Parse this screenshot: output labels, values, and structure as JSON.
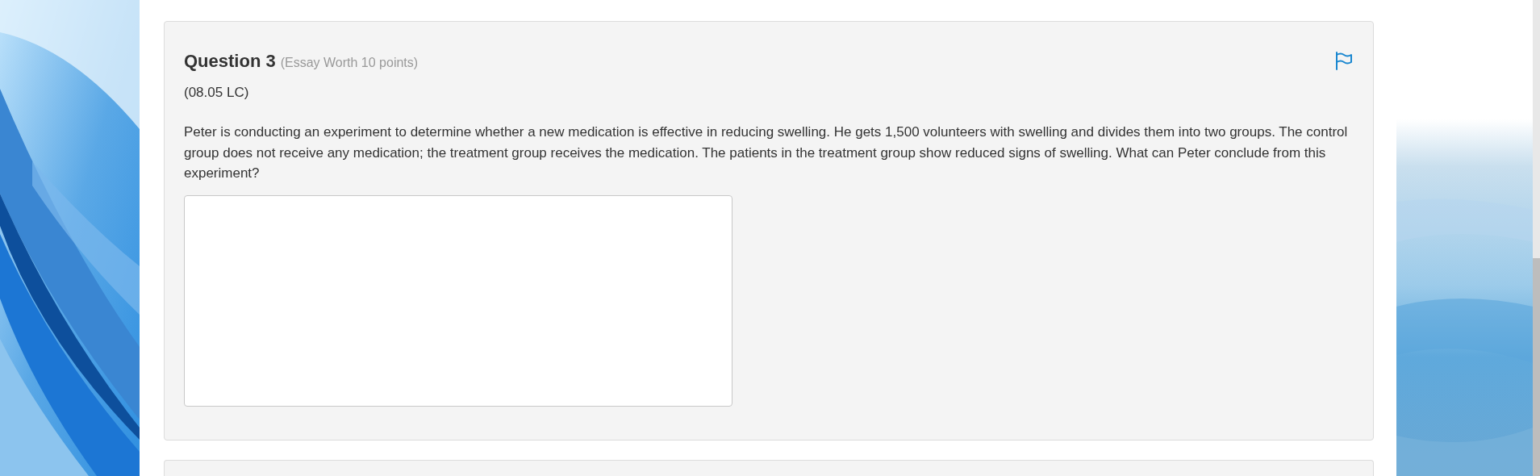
{
  "question": {
    "title": "Question 3",
    "meta": "(Essay Worth 10 points)",
    "code": "(08.05 LC)",
    "prompt": "Peter is conducting an experiment to determine whether a new medication is effective in reducing swelling. He gets 1,500 volunteers with swelling and divides them into two groups. The control group does not receive any medication; the treatment group receives the medication. The patients in the treatment group show reduced signs of swelling. What can Peter conclude from this experiment?",
    "flagged": false
  }
}
